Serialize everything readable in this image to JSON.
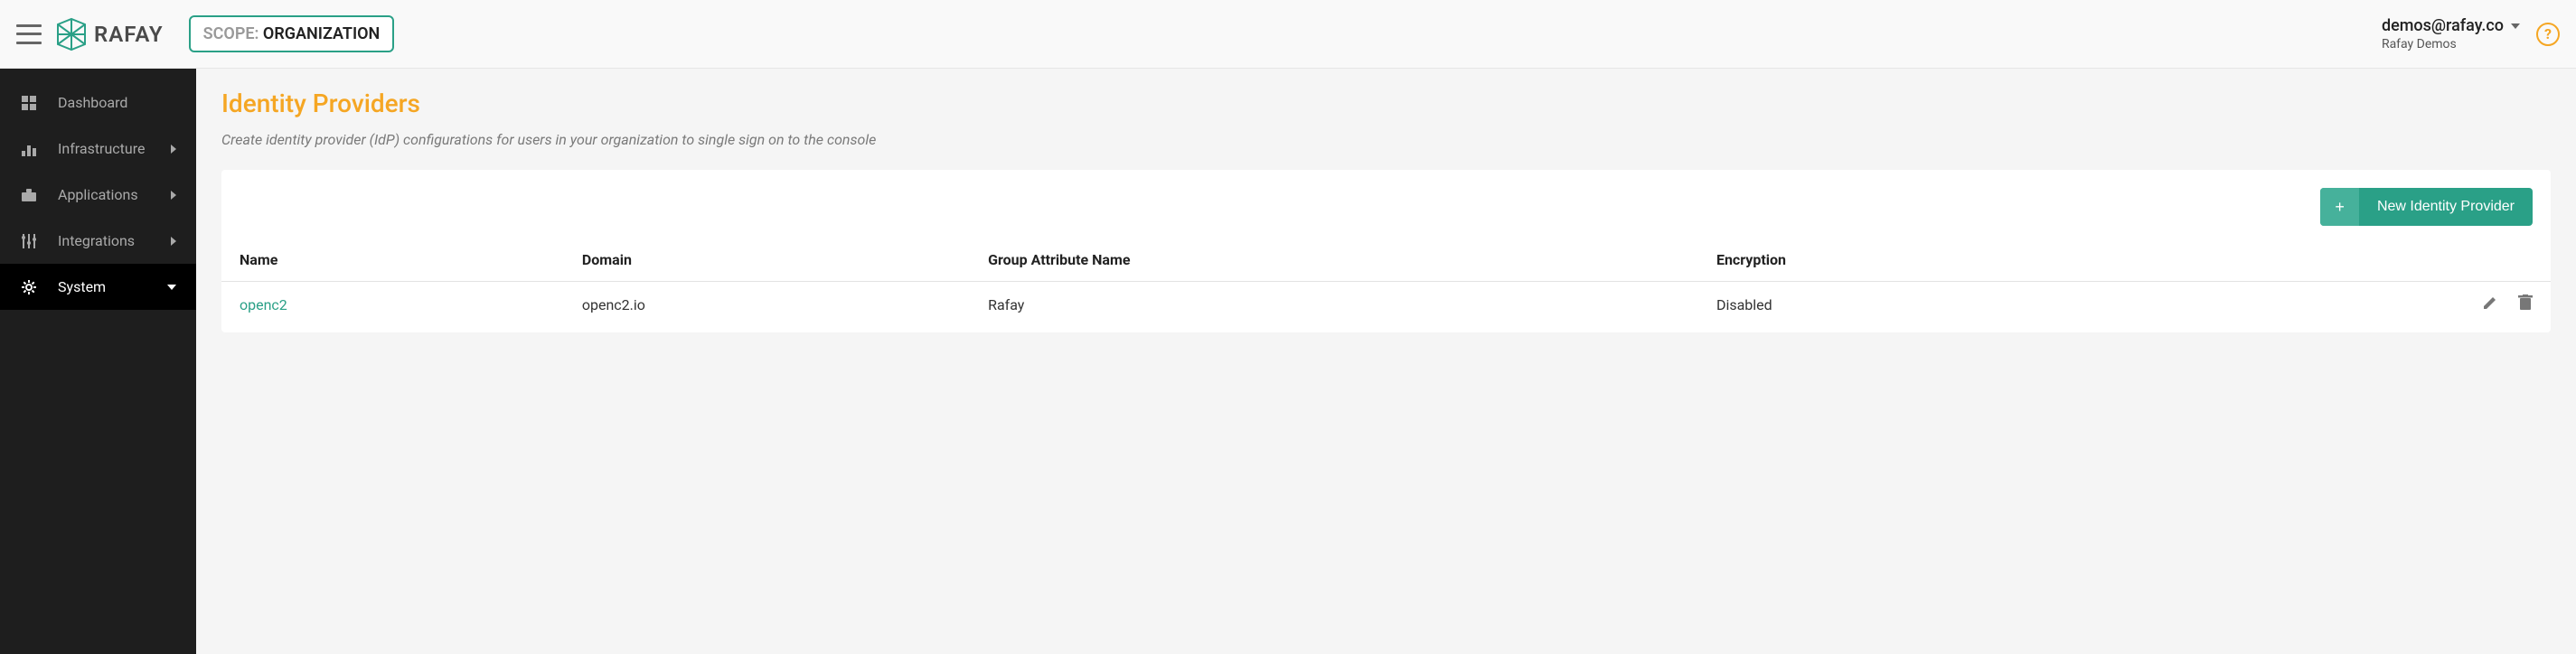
{
  "header": {
    "scope_label": "SCOPE: ",
    "scope_value": "ORGANIZATION",
    "user_email": "demos@rafay.co",
    "user_org": "Rafay Demos",
    "logo_text": "RAFAY",
    "help_glyph": "?"
  },
  "sidebar": {
    "items": [
      {
        "label": "Dashboard",
        "icon": "dashboard-icon",
        "has_chevron": false,
        "active": false
      },
      {
        "label": "Infrastructure",
        "icon": "infrastructure-icon",
        "has_chevron": true,
        "active": false
      },
      {
        "label": "Applications",
        "icon": "applications-icon",
        "has_chevron": true,
        "active": false
      },
      {
        "label": "Integrations",
        "icon": "integrations-icon",
        "has_chevron": true,
        "active": false
      },
      {
        "label": "System",
        "icon": "gear-icon",
        "has_chevron": true,
        "active": true
      }
    ]
  },
  "main": {
    "title": "Identity Providers",
    "subtitle": "Create identity provider (IdP) configurations for users in your organization to single sign on to the console",
    "new_button_label": "New Identity Provider",
    "plus_glyph": "+",
    "columns": [
      "Name",
      "Domain",
      "Group Attribute Name",
      "Encryption"
    ],
    "rows": [
      {
        "name": "openc2",
        "domain": "openc2.io",
        "group_attr": "Rafay",
        "encryption": "Disabled"
      }
    ]
  }
}
